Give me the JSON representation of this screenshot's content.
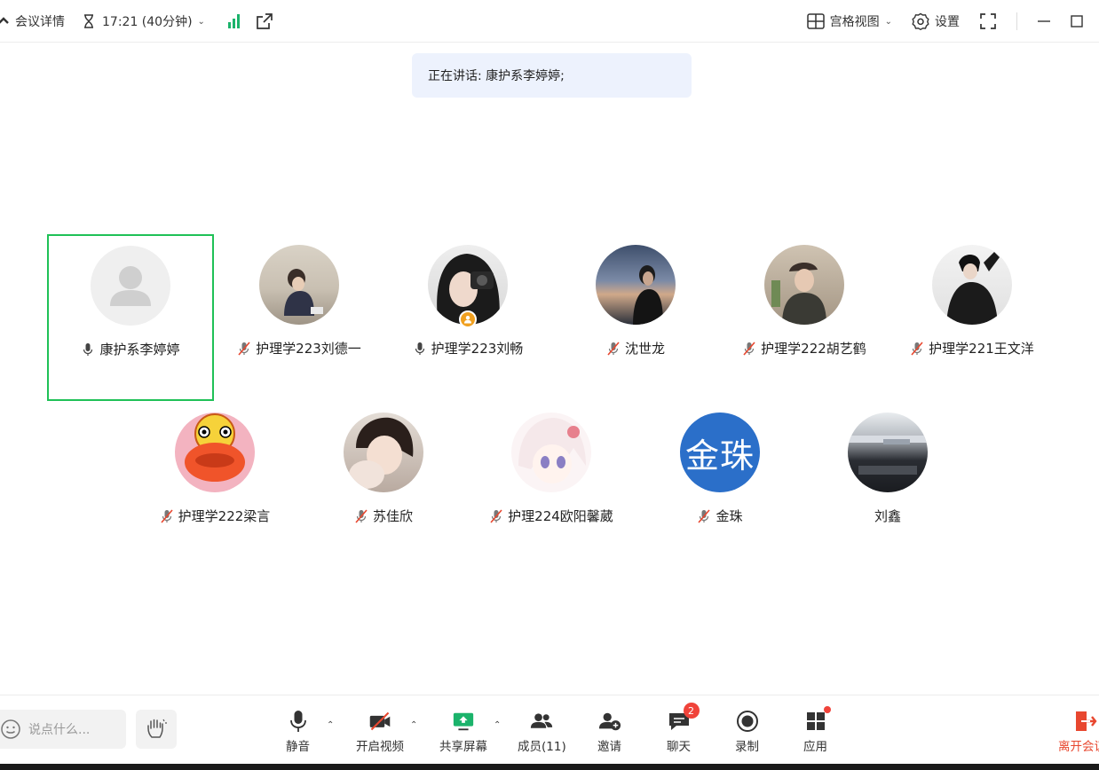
{
  "header": {
    "details_label": "会议详情",
    "timer": "17:21 (40分钟)",
    "view_label": "宫格视图",
    "settings_label": "设置"
  },
  "speaking": {
    "text": "正在讲话: 康护系李婷婷;"
  },
  "participants": [
    {
      "name": "康护系李婷婷",
      "mic": "on",
      "avatar": "default"
    },
    {
      "name": "护理学223刘德一",
      "mic": "muted",
      "avatar": "photo-sitting"
    },
    {
      "name": "护理学223刘畅",
      "mic": "on",
      "avatar": "photo-camera",
      "host": true
    },
    {
      "name": "沈世龙",
      "mic": "muted",
      "avatar": "photo-sky"
    },
    {
      "name": "护理学222胡艺鹤",
      "mic": "muted",
      "avatar": "photo-cap"
    },
    {
      "name": "护理学221王文洋",
      "mic": "muted",
      "avatar": "photo-dark"
    },
    {
      "name": "护理学222梁言",
      "mic": "muted",
      "avatar": "cartoon"
    },
    {
      "name": "苏佳欣",
      "mic": "muted",
      "avatar": "photo-baby"
    },
    {
      "name": "护理224欧阳馨葳",
      "mic": "muted",
      "avatar": "anime"
    },
    {
      "name": "金珠",
      "mic": "muted",
      "avatar": "text",
      "avatar_text": "金珠",
      "avatar_color": "#2b6fc9"
    },
    {
      "name": "刘鑫",
      "mic": "none",
      "avatar": "photo-airport"
    }
  ],
  "toolbar": {
    "chat_placeholder": "说点什么...",
    "mute": "静音",
    "video": "开启视频",
    "share": "共享屏幕",
    "members": "成员(11)",
    "invite": "邀请",
    "chat": "聊天",
    "chat_badge": "2",
    "record": "录制",
    "apps": "应用",
    "leave": "离开会议"
  },
  "colors": {
    "active_border": "#1fc157",
    "signal": "#1bb36b",
    "leave": "#e8472f",
    "badge": "#f0433a"
  }
}
